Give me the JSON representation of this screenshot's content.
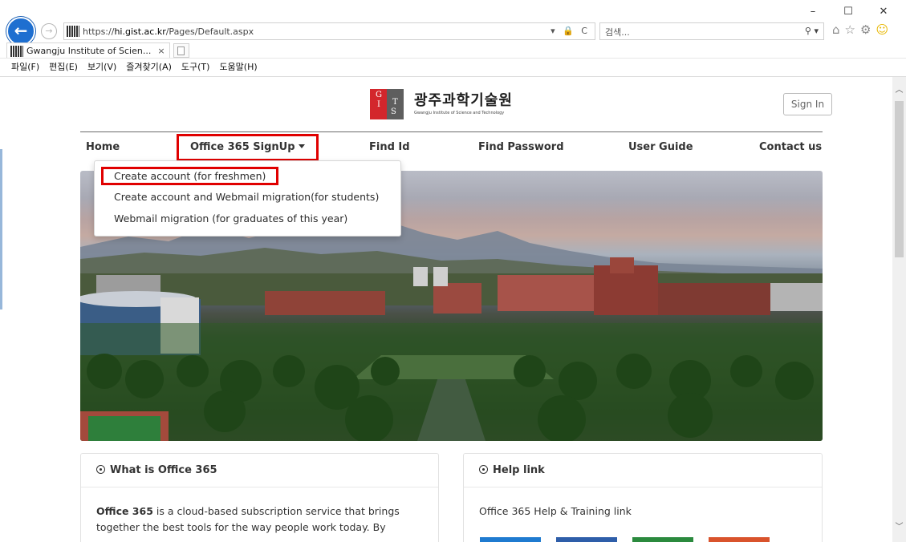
{
  "browser": {
    "url_prefix": "https://",
    "url_domain": "hi.gist.ac.kr",
    "url_path": "/Pages/Default.aspx",
    "address_tools": "▾ 🔒 C",
    "search_placeholder": "검색...",
    "search_icon": "⚲ ▾",
    "tab_title": "Gwangju Institute of Scien...",
    "tab_close": "×",
    "window_controls": [
      "–",
      "☐",
      "✕"
    ],
    "nav_back": "←",
    "nav_forward": "→",
    "toolbar_icons": [
      "home-icon",
      "star-icon",
      "gear-icon",
      "smiley-icon"
    ],
    "menu": [
      "파일(F)",
      "편집(E)",
      "보기(V)",
      "즐겨찾기(A)",
      "도구(T)",
      "도움말(H)"
    ]
  },
  "header": {
    "logo_letters": [
      "G",
      "I",
      "S",
      "T"
    ],
    "logo_korean": "광주과학기술원",
    "logo_english": "Gwangju Institute of Science and Technology",
    "signin_label": "Sign In"
  },
  "nav": {
    "items": [
      "Home",
      "Office 365 SignUp",
      "Find Id",
      "Find Password",
      "User Guide",
      "Contact us"
    ],
    "dropdown": [
      "Create account (for freshmen)",
      "Create account and Webmail migration(for students)",
      "Webmail migration (for graduates of this year)"
    ]
  },
  "cards": {
    "office": {
      "title": "What is Office 365",
      "body_strong": "Office 365",
      "body_line1": " is a cloud-based subscription service that brings",
      "body_line2": "together the best tools for the way people work today. By"
    },
    "help": {
      "title": "Help link",
      "body": "Office 365 Help & Training link",
      "tile_colors": [
        "#1f7bd0",
        "#2e5ea9",
        "#2b8a3e",
        "#d9532c"
      ]
    }
  },
  "colors": {
    "highlight": "#e00000",
    "back_button": "#1e6fd0",
    "logo_red": "#d3262c"
  }
}
